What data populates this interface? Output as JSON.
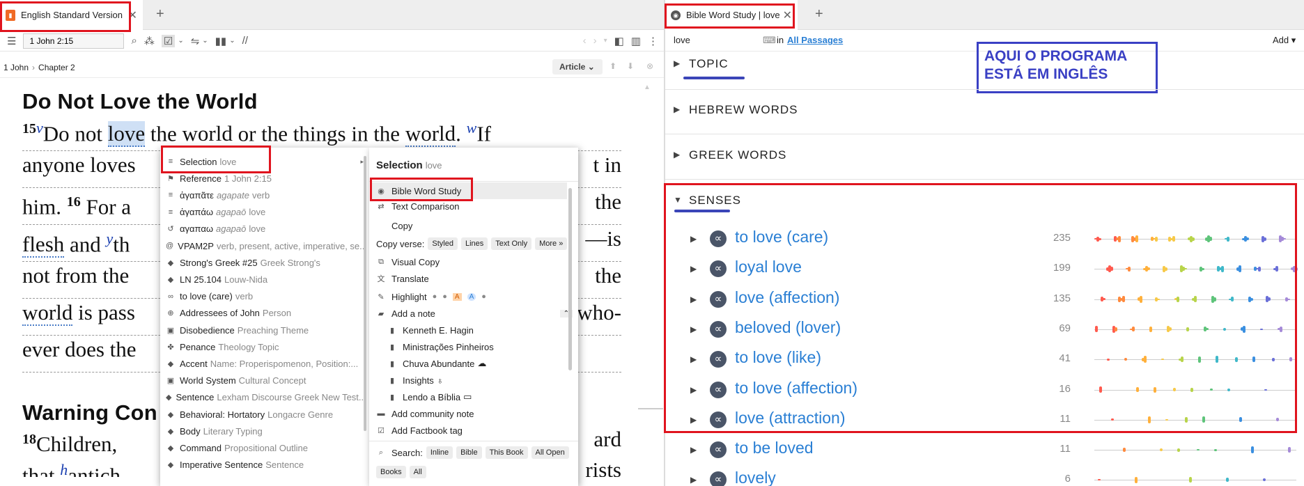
{
  "left_tab": {
    "title": "English Standard Version"
  },
  "toolbar_left": {
    "reference": "1 John 2:15",
    "sync": "//"
  },
  "breadcrumb": {
    "book": "1 John",
    "chapter": "Chapter 2",
    "article": "Article"
  },
  "bible": {
    "heading1": "Do Not Love the World",
    "line1": {
      "vnum": "15",
      "fn1": "v",
      "pre": "Do not ",
      "sel": "love",
      "mid": " the ",
      "w1": "world",
      "mid2": " or the things in the ",
      "w2": "world",
      "post": ". ",
      "fn2": "w",
      "end": "If"
    },
    "line2": {
      "a": "anyone loves",
      "b": "t in"
    },
    "line3": {
      "a": "him.",
      "vnum": "16",
      "b": " For a",
      "c": "the"
    },
    "line4": {
      "a": "flesh",
      "b": " and ",
      "fn": "y",
      "c": "th",
      "d": "—is"
    },
    "line5": {
      "a": "not from the",
      "b": "the"
    },
    "line6": {
      "a": "world",
      "b": " is pass",
      "c": "who-"
    },
    "line7": {
      "a": "ever does the"
    },
    "heading2": "Warning Con",
    "line8": {
      "vnum": "18",
      "a": "Children,",
      "b": "ard"
    },
    "line9": {
      "a": "that",
      "fn": "h",
      "b": "antich",
      "c": "rists"
    }
  },
  "menu1": {
    "items": [
      {
        "icon": "≡",
        "main": "Selection",
        "sub": "love",
        "arrow": true
      },
      {
        "icon": "⚑",
        "main": "Reference",
        "sub": "1 John 2:15"
      },
      {
        "icon": "≡",
        "main": "ἀγαπᾶτε",
        "sub": "agapate verb",
        "sub_italic": "agapate",
        "expand": true
      },
      {
        "icon": "≡",
        "main": "ἀγαπάω",
        "sub_italic": "agapaō",
        "sub": "love"
      },
      {
        "icon": "↺",
        "main": "αγαπαω",
        "sub_italic": "agapaō",
        "sub": "love"
      },
      {
        "icon": "@",
        "main": "VPAM2P",
        "sub": "verb, present, active, imperative, se..."
      },
      {
        "icon": "◆",
        "main": "Strong's Greek #25",
        "sub": "Greek Strong's"
      },
      {
        "icon": "◆",
        "main": "LN 25.104",
        "sub": "Louw-Nida"
      },
      {
        "icon": "∞",
        "main": "to love (care)",
        "sub": "verb"
      },
      {
        "icon": "⊕",
        "main": "Addressees of John",
        "sub": "Person"
      },
      {
        "icon": "▣",
        "main": "Disobedience",
        "sub": "Preaching Theme",
        "expand": true
      },
      {
        "icon": "✤",
        "main": "Penance",
        "sub": "Theology Topic",
        "expand": true
      },
      {
        "icon": "◆",
        "main": "Accent",
        "sub": "Name: Properispomenon, Position:...",
        "expand": true
      },
      {
        "icon": "▣",
        "main": "World System",
        "sub": "Cultural Concept"
      },
      {
        "icon": "◆",
        "main": "Sentence",
        "sub": "Lexham Discourse Greek New Test..."
      },
      {
        "icon": "◆",
        "main": "Behavioral: Hortatory",
        "sub": "Longacre Genre"
      },
      {
        "icon": "◆",
        "main": "Body",
        "sub": "Literary Typing",
        "expand": true
      },
      {
        "icon": "◆",
        "main": "Command",
        "sub": "Propositional Outline"
      },
      {
        "icon": "◆",
        "main": "Imperative Sentence",
        "sub": "Sentence"
      }
    ]
  },
  "menu2": {
    "title": "Selection",
    "title_sub": "love",
    "bible_word_study": "Bible Word Study",
    "text_comparison": "Text Comparison",
    "copy": "Copy",
    "copy_verse": "Copy verse:",
    "copy_chips": [
      "Styled",
      "Lines",
      "Text Only",
      "More »"
    ],
    "visual_copy": "Visual Copy",
    "translate": "Translate",
    "highlight": "Highlight",
    "add_note": "Add a note",
    "notes": [
      "Kenneth E. Hagin",
      "Ministrações Pinheiros",
      "Chuva Abundante",
      "Insights",
      "Lendo a Bíblia"
    ],
    "add_community_note": "Add community note",
    "add_factbook_tag": "Add Factbook tag",
    "search": "Search:",
    "search_chips": [
      "Inline",
      "Bible",
      "This Book",
      "All Open",
      "Books",
      "All"
    ]
  },
  "right_tab": {
    "title": "Bible Word Study | love"
  },
  "toolbar_right": {
    "query": "love",
    "in_label": "in",
    "scope": "All Passages",
    "add": "Add"
  },
  "note": {
    "line1": "AQUI O PROGRAMA",
    "line2": "ESTÁ EM INGLÊS"
  },
  "sections": {
    "topic": "TOPIC",
    "hebrew": "HEBREW WORDS",
    "greek": "GREEK WORDS",
    "senses": "SENSES"
  },
  "senses": [
    {
      "label": "to love (care)",
      "count": "235"
    },
    {
      "label": "loyal love",
      "count": "199"
    },
    {
      "label": "love (affection)",
      "count": "135"
    },
    {
      "label": "beloved (lover)",
      "count": "69"
    },
    {
      "label": "to love (like)",
      "count": "41"
    },
    {
      "label": "to love (affection)",
      "count": "16"
    },
    {
      "label": "love (attraction)",
      "count": "11"
    },
    {
      "label": "to be loved",
      "count": "11"
    },
    {
      "label": "lovely",
      "count": "6"
    }
  ],
  "colors": {
    "accent_blue": "#2a7fd4",
    "highlight_red": "#e0141e",
    "annotation_blue": "#3a40c4",
    "logos_orange": "#f06a25"
  }
}
